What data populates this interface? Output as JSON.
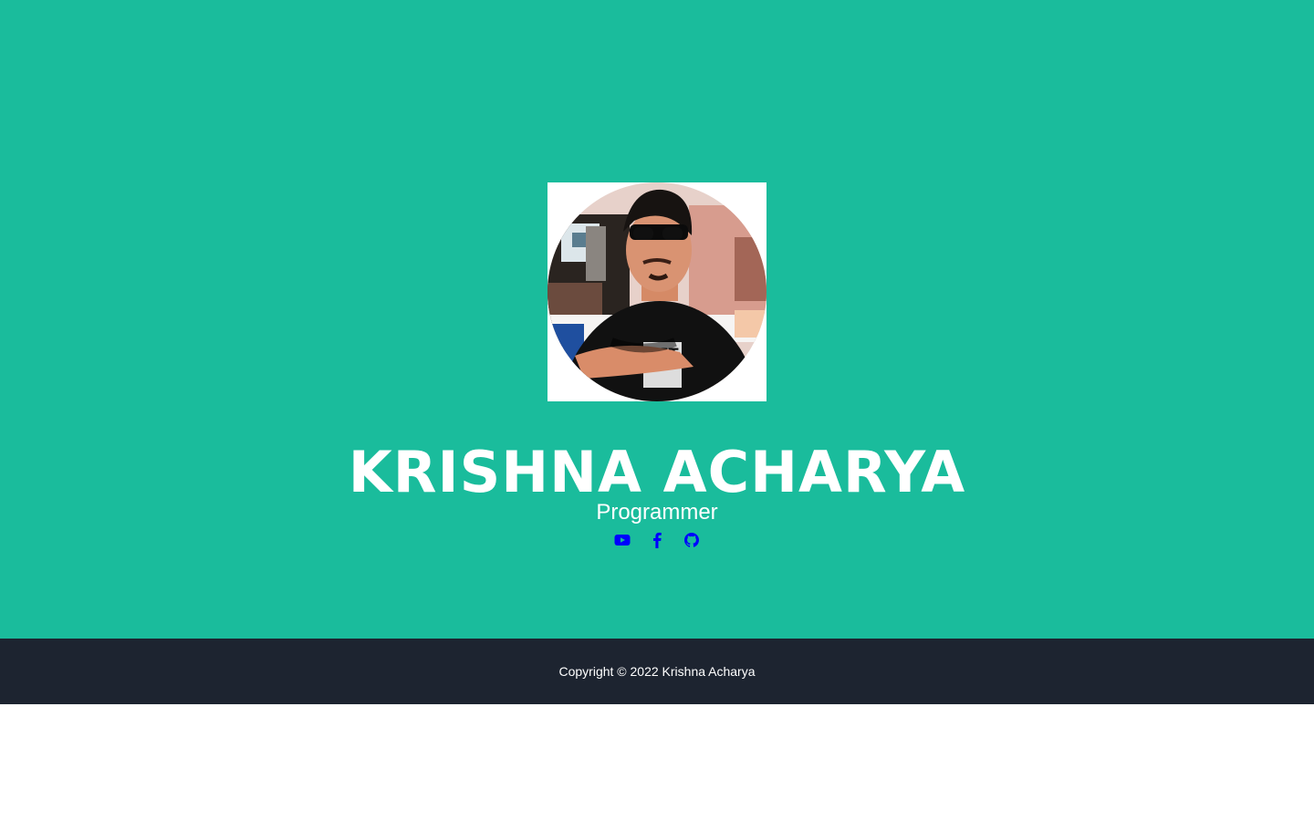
{
  "profile": {
    "name": "KRISHNA ACHARYA",
    "role": "Programmer",
    "avatar_icon": "person-photo"
  },
  "social": [
    {
      "icon": "youtube-icon"
    },
    {
      "icon": "facebook-icon"
    },
    {
      "icon": "github-icon"
    }
  ],
  "footer": {
    "copyright": "Copyright © 2022 Krishna Acharya"
  },
  "colors": {
    "hero_background": "#1abc9c",
    "footer_background": "#1d2430",
    "text": "#ffffff",
    "icon": "#0000ff"
  }
}
